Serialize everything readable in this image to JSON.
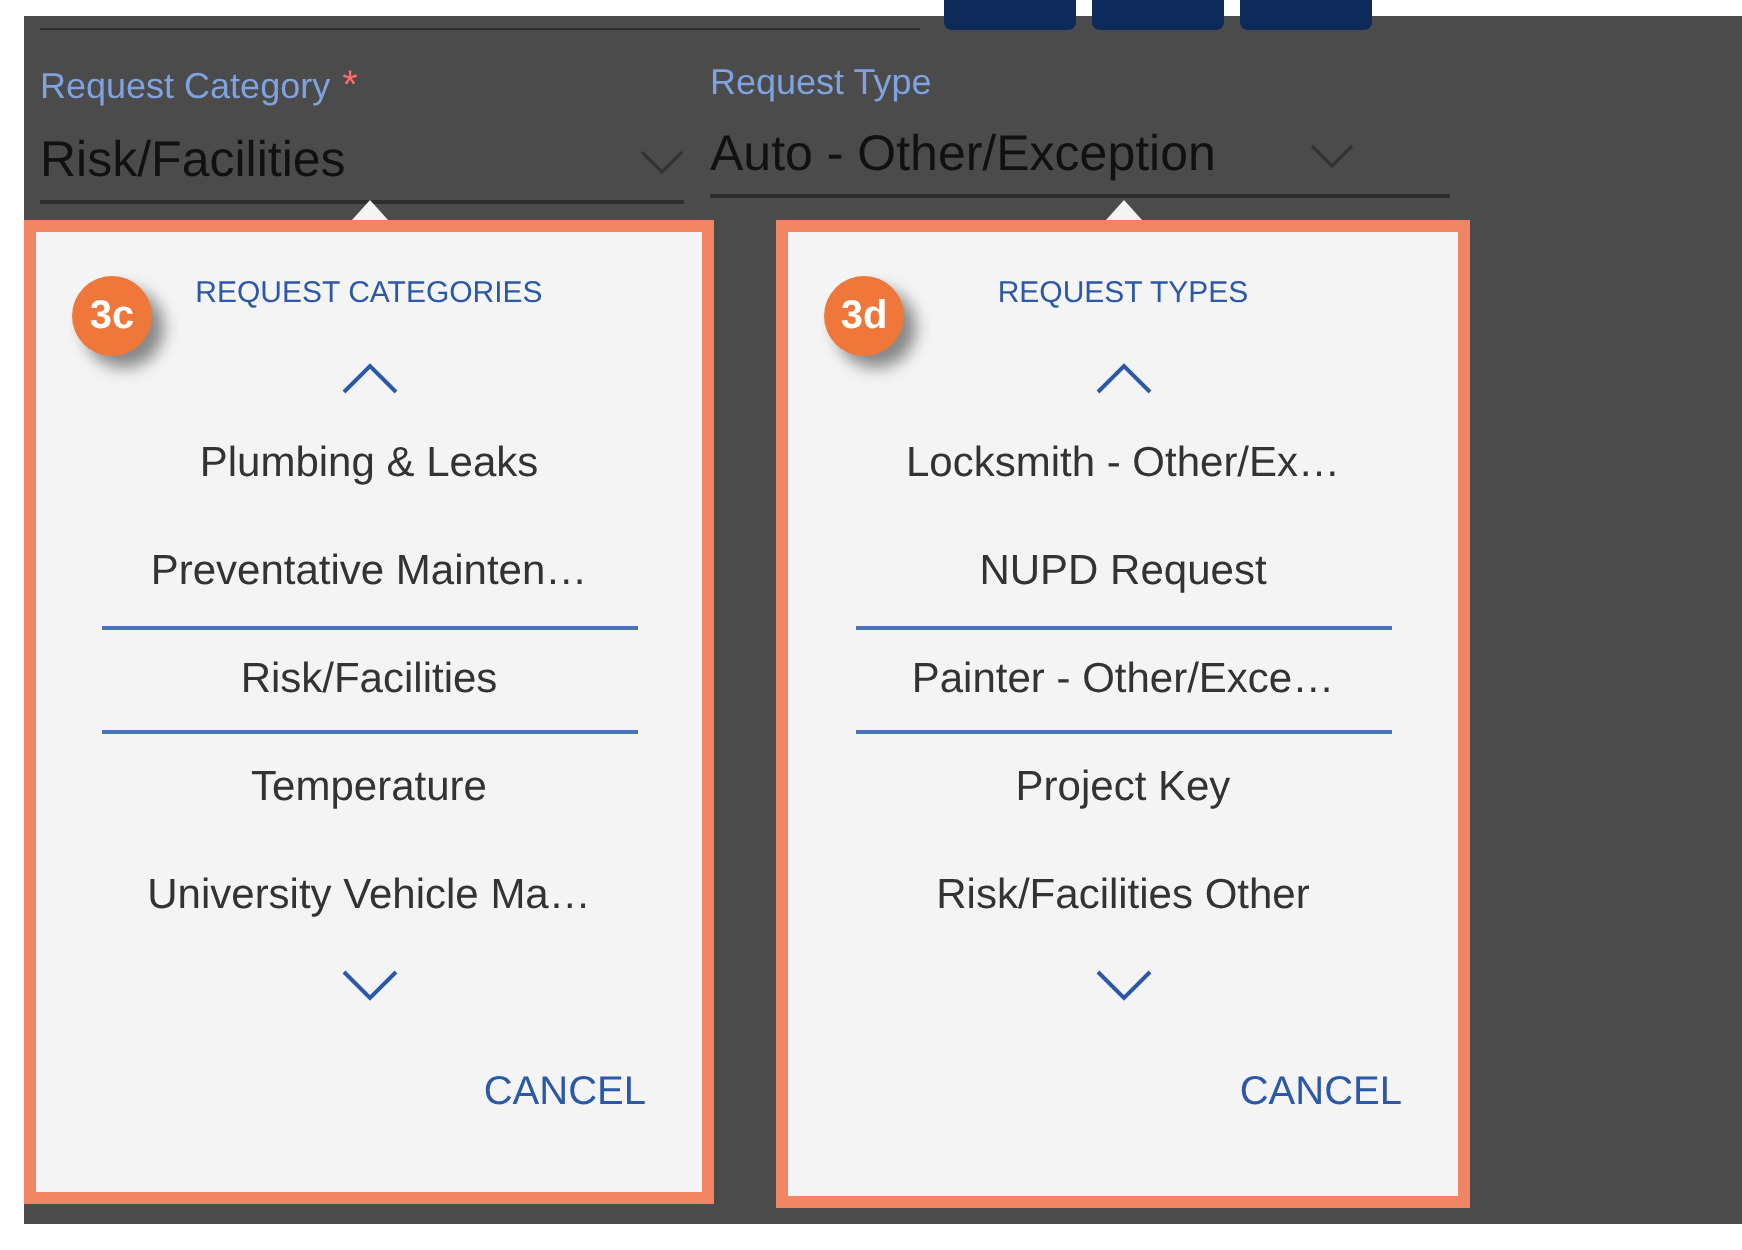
{
  "fields": [
    {
      "label": "Request Category",
      "required_mark": "*",
      "value": "Risk/Facilities"
    },
    {
      "label": "Request Type",
      "value": "Auto - Other/Exception"
    }
  ],
  "pickers": [
    {
      "badge": "3c",
      "title": "REQUEST CATEGORIES",
      "items": [
        {
          "text": "Plumbing & Leaks",
          "selected": false
        },
        {
          "text": "Preventative Mainten…",
          "selected": false
        },
        {
          "text": "Risk/Facilities",
          "selected": true
        },
        {
          "text": "Temperature",
          "selected": false
        },
        {
          "text": "University Vehicle Ma…",
          "selected": false
        }
      ],
      "cancel": "CANCEL"
    },
    {
      "badge": "3d",
      "title": "REQUEST TYPES",
      "items": [
        {
          "text": "Locksmith - Other/Ex…",
          "selected": false
        },
        {
          "text": "NUPD Request",
          "selected": false
        },
        {
          "text": "Painter - Other/Exce…",
          "selected": true
        },
        {
          "text": "Project Key",
          "selected": false
        },
        {
          "text": "Risk/Facilities Other",
          "selected": false
        }
      ],
      "cancel": "CANCEL"
    }
  ]
}
